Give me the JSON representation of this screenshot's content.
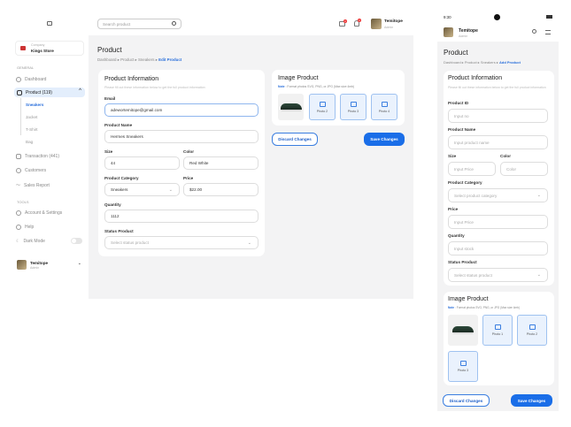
{
  "sidebar": {
    "company_label": "Company",
    "company_name": "Kings Store",
    "general_label": "GENERAL",
    "tools_label": "TOOLS",
    "items": [
      {
        "label": "Dashboard"
      },
      {
        "label": "Product (119)"
      },
      {
        "label": "Transaction (441)"
      },
      {
        "label": "Customers"
      },
      {
        "label": "Sales Report"
      }
    ],
    "subitems": [
      {
        "label": "Sneakers"
      },
      {
        "label": "Jacket"
      },
      {
        "label": "T-Shirt"
      },
      {
        "label": "Bag"
      }
    ],
    "tools": [
      {
        "label": "Account & Settings"
      },
      {
        "label": "Help"
      },
      {
        "label": "Dark Mode"
      }
    ],
    "user": {
      "name": "Temitope",
      "role": "Admin"
    }
  },
  "topbar": {
    "search_placeholder": "Search product",
    "user_name": "Temitope",
    "user_role": "Admin",
    "mail_badge": "1",
    "bell_badge": "1"
  },
  "desktop": {
    "title": "Product",
    "breadcrumb": [
      "Dashboard",
      "Product",
      "Sneakers"
    ],
    "breadcrumb_current": "Edit Product",
    "info_title": "Product Information",
    "info_sub": "Please fill out these information below to get the full product information",
    "fields": {
      "email_label": "Email",
      "email": "adewortemitope@gmail.com",
      "name_label": "Product Name",
      "name": "Hermes Sneakers",
      "size_label": "Size",
      "size": "44",
      "color_label": "Color",
      "color": "Red White",
      "category_label": "Product Category",
      "category": "Sneakers",
      "price_label": "Price",
      "price": "$22.00",
      "qty_label": "Quantity",
      "qty": "1112",
      "status_label": "Status Product",
      "status_placeholder": "Select status product"
    },
    "image_title": "Image Product",
    "note_label": "Note",
    "note": ": Format photos SVG, PNG, or JPG (Max size 4mb)",
    "photos": [
      "Photo 2",
      "Photo 3",
      "Photo 4"
    ],
    "discard": "Discard Changes",
    "save": "Save Changes"
  },
  "mobile": {
    "time": "9:30",
    "user_name": "Temitope",
    "user_role": "Admin",
    "title": "Product",
    "breadcrumb": [
      "Dashboard",
      "Product",
      "Sneakers"
    ],
    "breadcrumb_current": "Add Product",
    "info_title": "Product Information",
    "info_sub": "Please fill out these information below to get the full product information",
    "fields": {
      "id_label": "Product ID",
      "id_ph": "Input no",
      "name_label": "Product Name",
      "name_ph": "Input product name",
      "size_label": "Size",
      "size_ph": "Input Price",
      "color_label": "Color",
      "color_ph": "Color",
      "category_label": "Product Category",
      "category_ph": "Select product category",
      "price_label": "Price",
      "price_ph": "Input Price",
      "qty_label": "Quantity",
      "qty_ph": "Input stock",
      "status_label": "Status Product",
      "status_ph": "Select status product"
    },
    "image_title": "Image Product",
    "note_label": "Note",
    "note": ": Format photos SVG, PNG, or JPG (Max size 4mb)",
    "photos": [
      "Photo 1",
      "Photo 2",
      "Photo 3"
    ],
    "discard": "Discard Changes",
    "save": "Save Changes"
  }
}
